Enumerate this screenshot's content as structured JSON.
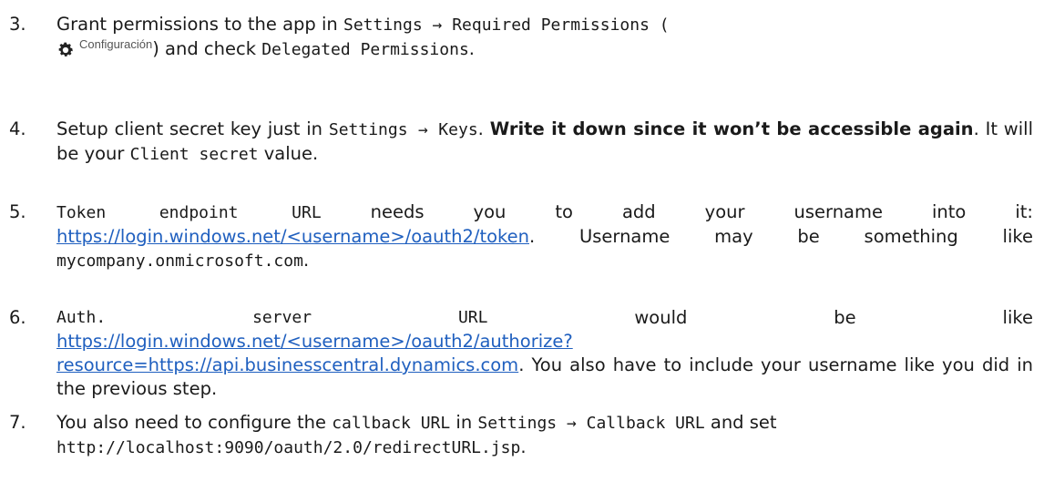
{
  "steps": [
    {
      "number": "3.",
      "part1": "Grant permissions to the app in ",
      "code1": "Settings → Required Permissions (",
      "config_label": "Configuración",
      "part2": ") and check ",
      "code2": "Delegated Permissions",
      "part3": "."
    },
    {
      "number": "4.",
      "part1": "Setup client secret key just in ",
      "code1": "Settings → Keys",
      "part2": ". ",
      "bold": "Write it down since it won’t be accessible again",
      "part3": ". It will be your ",
      "code2": "Client secret",
      "part4": " value."
    },
    {
      "number": "5.",
      "code1": "Token endpoint URL",
      "part1": " needs you to add your username into it:",
      "link": "https://login.windows.net/<username>/oauth2/token",
      "part2": ". Username may be something like ",
      "code2": "mycompany.onmicrosoft.com",
      "part3": "."
    },
    {
      "number": "6.",
      "code1a": "Auth.",
      "code1b": "server",
      "code1c": "URL",
      "w1": "would",
      "w2": "be",
      "w3": "like",
      "link_line1": "https://login.windows.net/<username>/oauth2/authorize?",
      "link_line2": "resource=https://api.businesscentral.dynamics.com",
      "part1": ". You also have to include your username like you did in the previous step."
    },
    {
      "number": "7.",
      "part1": "You also need to configure the ",
      "code1": "callback URL",
      "part2": " in ",
      "code2": "Settings → Callback URL",
      "part3": " and set",
      "code3": "http://localhost:9090/oauth/2.0/redirectURL.jsp",
      "part4": "."
    }
  ],
  "icons": {
    "gear": "gear-icon"
  }
}
